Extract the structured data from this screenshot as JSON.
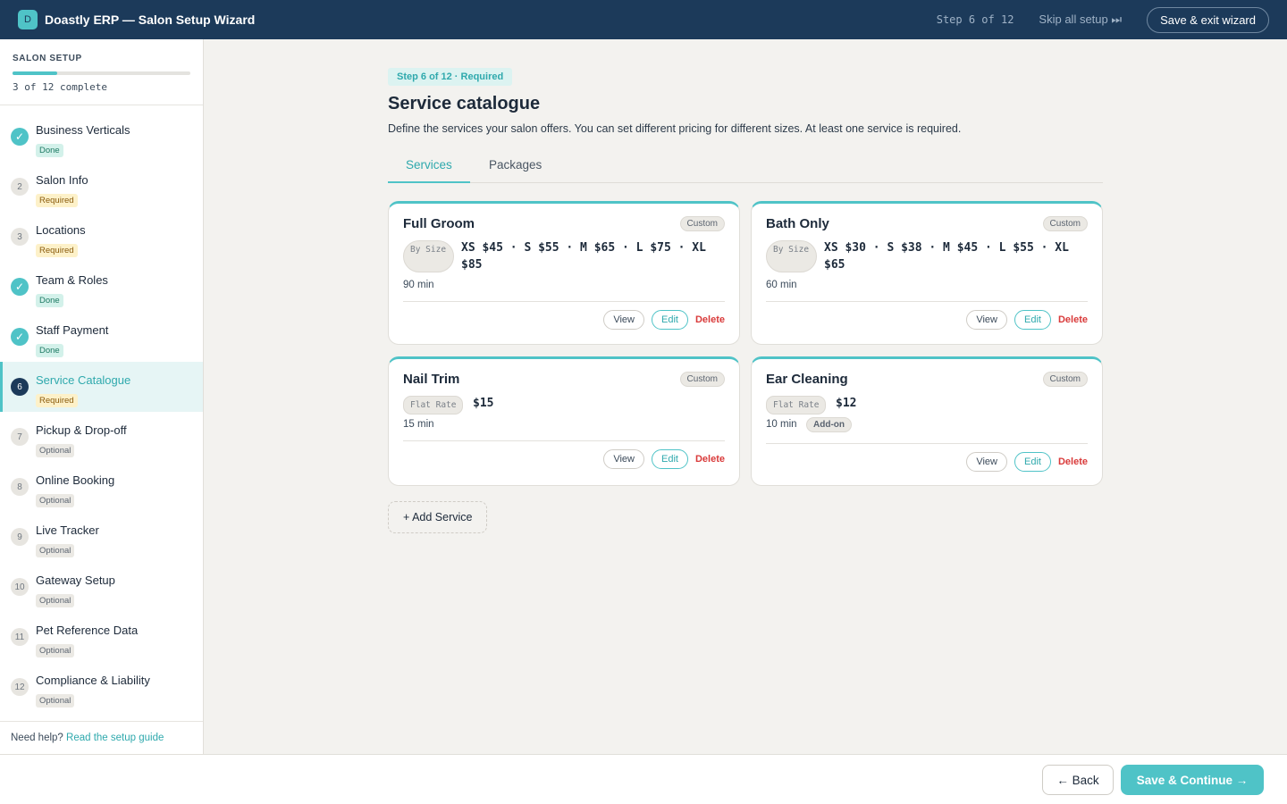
{
  "header": {
    "logo_letter": "D",
    "title": "Doastly ERP — Salon Setup Wizard",
    "step_indicator": "Step 6 of 12",
    "skip_label": "Skip all setup ⏭",
    "exit_label": "Save & exit wizard"
  },
  "sidebar": {
    "title": "SALON SETUP",
    "progress_fraction": 0.25,
    "progress_text": "3 of 12 complete",
    "items": [
      {
        "num": "✓",
        "label": "Business Verticals",
        "status": "Done"
      },
      {
        "num": "2",
        "label": "Salon Info",
        "status": "Required"
      },
      {
        "num": "3",
        "label": "Locations",
        "status": "Required"
      },
      {
        "num": "✓",
        "label": "Team & Roles",
        "status": "Done"
      },
      {
        "num": "✓",
        "label": "Staff Payment",
        "status": "Done"
      },
      {
        "num": "6",
        "label": "Service Catalogue",
        "status": "Required"
      },
      {
        "num": "7",
        "label": "Pickup & Drop-off",
        "status": "Optional"
      },
      {
        "num": "8",
        "label": "Online Booking",
        "status": "Optional"
      },
      {
        "num": "9",
        "label": "Live Tracker",
        "status": "Optional"
      },
      {
        "num": "10",
        "label": "Gateway Setup",
        "status": "Optional"
      },
      {
        "num": "11",
        "label": "Pet Reference Data",
        "status": "Optional"
      },
      {
        "num": "12",
        "label": "Compliance & Liability",
        "status": "Optional"
      }
    ],
    "help_text": "Need help?",
    "help_link": "Read the setup guide"
  },
  "main": {
    "step_pill": "Step 6 of 12 · Required",
    "title": "Service catalogue",
    "description": "Define the services your salon offers. You can set different pricing for different sizes. At least one service is required.",
    "tabs": [
      {
        "label": "Services"
      },
      {
        "label": "Packages"
      }
    ],
    "services": [
      {
        "name": "Full Groom",
        "badge": "Custom",
        "pricing_type": "By Size",
        "price": "XS $45 · S $55 · M $65 · L $75 · XL $85",
        "duration": "90 min"
      },
      {
        "name": "Bath Only",
        "badge": "Custom",
        "pricing_type": "By Size",
        "price": "XS $30 · S $38 · M $45 · L $55 · XL $65",
        "duration": "60 min"
      },
      {
        "name": "Nail Trim",
        "badge": "Custom",
        "pricing_type": "Flat Rate",
        "price": "$15",
        "duration": "15 min"
      },
      {
        "name": "Ear Cleaning",
        "badge": "Custom",
        "pricing_type": "Flat Rate",
        "price": "$12",
        "duration": "10 min",
        "addon": "Add-on"
      }
    ],
    "actions": {
      "view": "View",
      "edit": "Edit",
      "delete": "Delete"
    },
    "add_service": "+ Add Service"
  },
  "footer": {
    "back_label": "← Back",
    "continue_label": "Save & Continue →"
  }
}
